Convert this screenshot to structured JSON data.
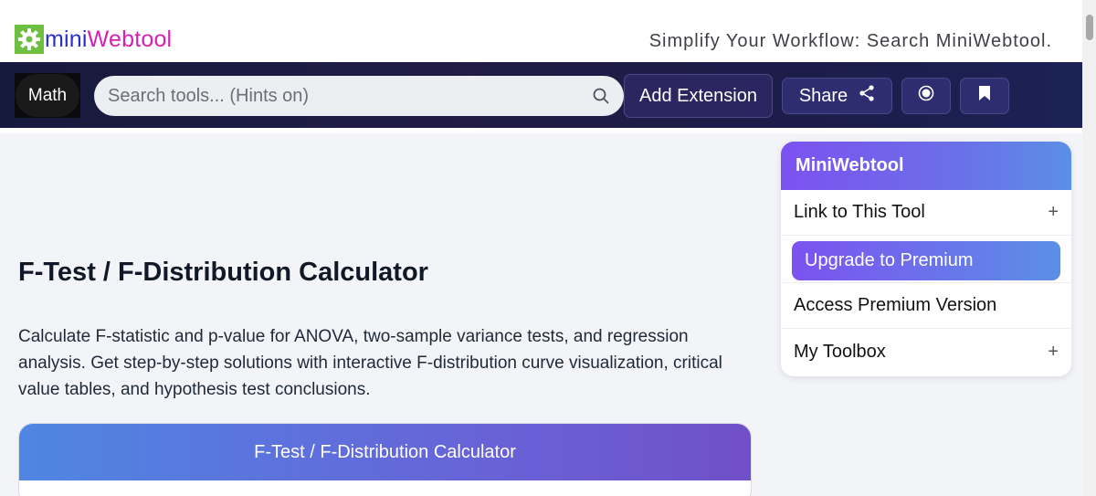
{
  "header": {
    "logo_part1": "mini",
    "logo_part2": "Webtool",
    "tagline": "Simplify Your Workflow: Search MiniWebtool."
  },
  "navbar": {
    "category": "Math",
    "search_placeholder": "Search tools... (Hints on)",
    "add_extension": "Add Extension",
    "share": "Share",
    "icons": [
      "search-icon",
      "share-icon",
      "record-icon",
      "bookmark-icon"
    ]
  },
  "main": {
    "title": "F-Test / F-Distribution Calculator",
    "description": "Calculate F-statistic and p-value for ANOVA, two-sample variance tests, and regression analysis. Get step-by-step solutions with interactive F-distribution curve visualization, critical value tables, and hypothesis test conclusions.",
    "calculator_title": "F-Test / F-Distribution Calculator"
  },
  "sidebar": {
    "title": "MiniWebtool",
    "link_to_tool": "Link to This Tool",
    "upgrade": "Upgrade to Premium",
    "access_premium": "Access Premium Version",
    "my_toolbox": "My Toolbox",
    "plus": "+"
  },
  "colors": {
    "logo_green": "#6cbf3f",
    "logo_blue": "#2b2fc9",
    "logo_magenta": "#d81fb5",
    "navbar_dark": "#1b1d45",
    "accent_purple": "#7c52f0",
    "accent_blue": "#5b8fe6"
  }
}
